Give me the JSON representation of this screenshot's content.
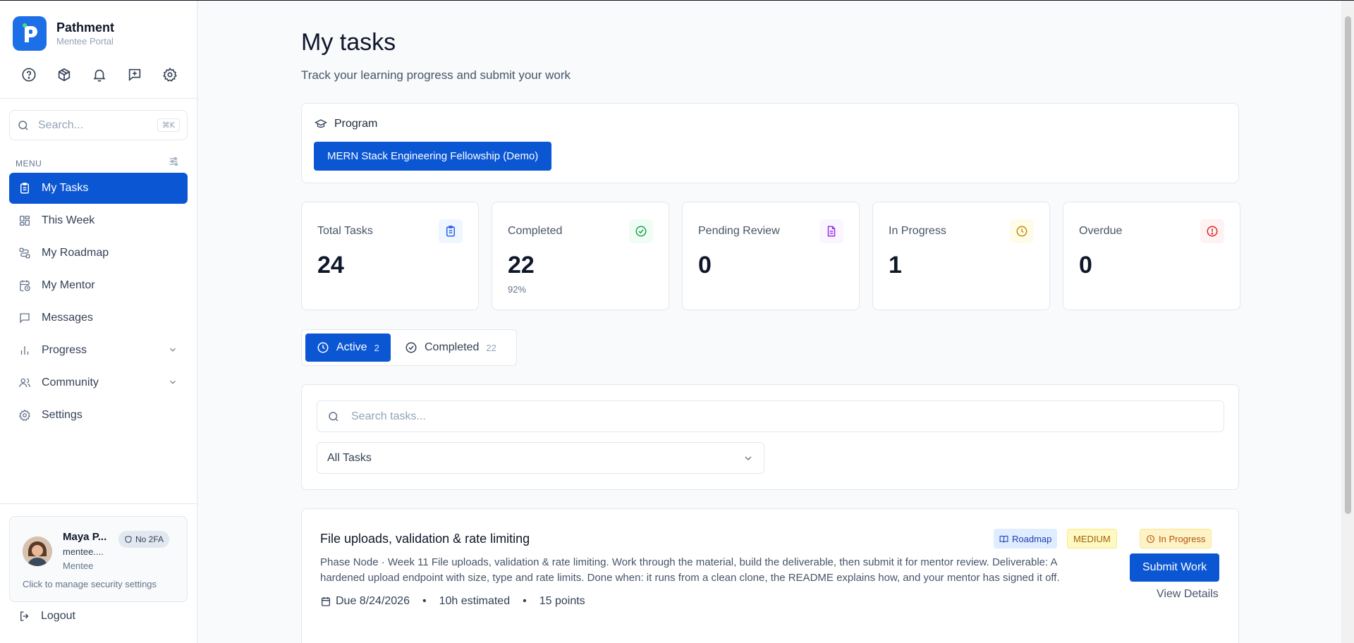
{
  "brand": {
    "name": "Pathment",
    "subtitle": "Mentee Portal"
  },
  "sidebar": {
    "search_placeholder": "Search...",
    "search_shortcut": "⌘K",
    "menu_heading": "MENU",
    "items": [
      {
        "label": "My Tasks",
        "icon": "clipboard-icon",
        "active": true
      },
      {
        "label": "This Week",
        "icon": "grid-icon"
      },
      {
        "label": "My Roadmap",
        "icon": "route-icon"
      },
      {
        "label": "My Mentor",
        "icon": "calendar-clock-icon"
      },
      {
        "label": "Messages",
        "icon": "message-icon"
      },
      {
        "label": "Progress",
        "icon": "bar-chart-icon",
        "expandable": true
      },
      {
        "label": "Community",
        "icon": "users-icon",
        "expandable": true
      },
      {
        "label": "Settings",
        "icon": "gear-icon"
      }
    ],
    "user": {
      "name": "Maya P...",
      "email": "mentee....",
      "role": "Mentee",
      "twofa_badge": "No 2FA",
      "hint": "Click to manage security settings"
    },
    "logout_label": "Logout"
  },
  "page": {
    "title": "My tasks",
    "subtitle": "Track your learning progress and submit your work"
  },
  "program": {
    "label": "Program",
    "selected": "MERN Stack Engineering Fellowship (Demo)"
  },
  "stats": [
    {
      "label": "Total Tasks",
      "value": "24",
      "note": "",
      "icon": "clipboard-icon",
      "color": "#2563eb",
      "bg": "#eff6ff"
    },
    {
      "label": "Completed",
      "value": "22",
      "note": "92%",
      "icon": "check-circle-icon",
      "color": "#16a34a",
      "bg": "#f0fdf4"
    },
    {
      "label": "Pending Review",
      "value": "0",
      "note": "",
      "icon": "document-icon",
      "color": "#9333ea",
      "bg": "#faf5ff"
    },
    {
      "label": "In Progress",
      "value": "1",
      "note": "",
      "icon": "clock-icon",
      "color": "#ca8a04",
      "bg": "#fefce8"
    },
    {
      "label": "Overdue",
      "value": "0",
      "note": "",
      "icon": "alert-circle-icon",
      "color": "#dc2626",
      "bg": "#fef2f2"
    }
  ],
  "tabs": {
    "active": {
      "label": "Active",
      "count": "2"
    },
    "completed": {
      "label": "Completed",
      "count": "22"
    }
  },
  "filters": {
    "search_placeholder": "Search tasks...",
    "select_value": "All Tasks"
  },
  "task": {
    "title": "File uploads, validation & rate limiting",
    "description": "Phase Node · Week 11 File uploads, validation & rate limiting. Work through the material, build the deliverable, then submit it for mentor review. Deliverable: A hardened upload endpoint with size, type and rate limits. Done when: it runs from a clean clone, the README explains how, and your mentor has signed it off.",
    "due": "Due 8/24/2026",
    "estimate": "10h estimated",
    "points": "15 points",
    "tag_roadmap": "Roadmap",
    "tag_priority": "MEDIUM",
    "status": "In Progress",
    "submit_label": "Submit Work",
    "details_label": "View Details"
  }
}
